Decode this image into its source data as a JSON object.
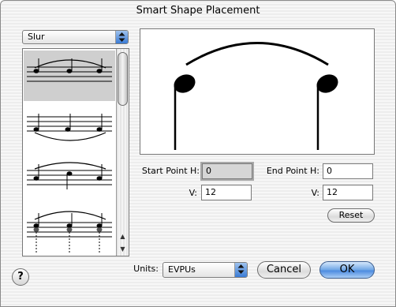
{
  "window": {
    "title": "Smart Shape Placement"
  },
  "shape_type": {
    "selected": "Slur"
  },
  "shapes": [
    {
      "name": "slur-over-notes-up",
      "selected": true
    },
    {
      "name": "slur-under-notes-up",
      "selected": false
    },
    {
      "name": "slur-over-mixed-stems",
      "selected": false
    },
    {
      "name": "slur-over-chords",
      "selected": false
    }
  ],
  "start_point": {
    "h_label": "Start Point H:",
    "h_value": "0",
    "v_label": "V:",
    "v_value": "12"
  },
  "end_point": {
    "h_label": "End Point H:",
    "h_value": "0",
    "v_label": "V:",
    "v_value": "12"
  },
  "reset_label": "Reset",
  "units": {
    "label": "Units:",
    "selected": "EVPUs"
  },
  "buttons": {
    "cancel": "Cancel",
    "ok": "OK",
    "help": "?"
  },
  "icons": {
    "popup_arrows": "up-down-arrows-icon",
    "scroll_up": "up-arrow-icon",
    "scroll_down": "down-arrow-icon"
  }
}
